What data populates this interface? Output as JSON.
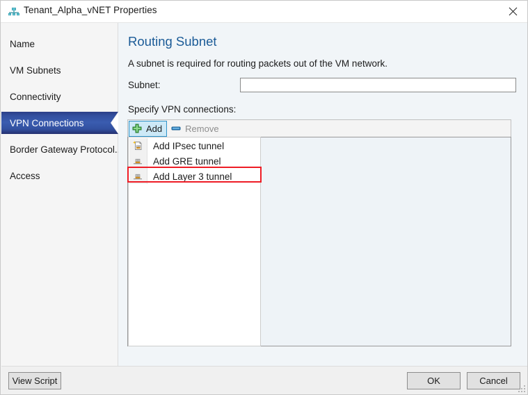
{
  "window": {
    "title": "Tenant_Alpha_vNET Properties",
    "icon": "network-vnet-icon",
    "close_label": "close-icon"
  },
  "sidebar": {
    "items": [
      {
        "label": "Name",
        "selected": false
      },
      {
        "label": "VM Subnets",
        "selected": false
      },
      {
        "label": "Connectivity",
        "selected": false
      },
      {
        "label": "VPN Connections",
        "selected": true
      },
      {
        "label": "Border Gateway Protocol...",
        "selected": false
      },
      {
        "label": "Access",
        "selected": false
      }
    ]
  },
  "pane": {
    "title": "Routing Subnet",
    "description": "A subnet is required for routing packets out of the VM network.",
    "subnet": {
      "label": "Subnet:",
      "value": "",
      "placeholder": ""
    },
    "specify_label": "Specify VPN connections:"
  },
  "toolbar": {
    "add_label": "Add",
    "add_icon": "plus-icon",
    "remove_label": "Remove",
    "remove_icon": "minus-icon"
  },
  "menu": {
    "items": [
      {
        "label": "Add IPsec tunnel",
        "icon": "new-tunnel-icon",
        "highlighted": false
      },
      {
        "label": "Add GRE tunnel",
        "icon": "tunnel-icon",
        "highlighted": false
      },
      {
        "label": "Add Layer 3 tunnel",
        "icon": "tunnel-icon",
        "highlighted": true
      }
    ]
  },
  "footer": {
    "view_script_label": "View Script",
    "ok_label": "OK",
    "cancel_label": "Cancel"
  },
  "colors": {
    "accent_blue": "#1b5b97",
    "selected_nav": "#33509f",
    "highlight_red": "#ee1c25",
    "toolbar_active_bg": "#cde9f7",
    "pane_bg": "#f1f5f8"
  }
}
